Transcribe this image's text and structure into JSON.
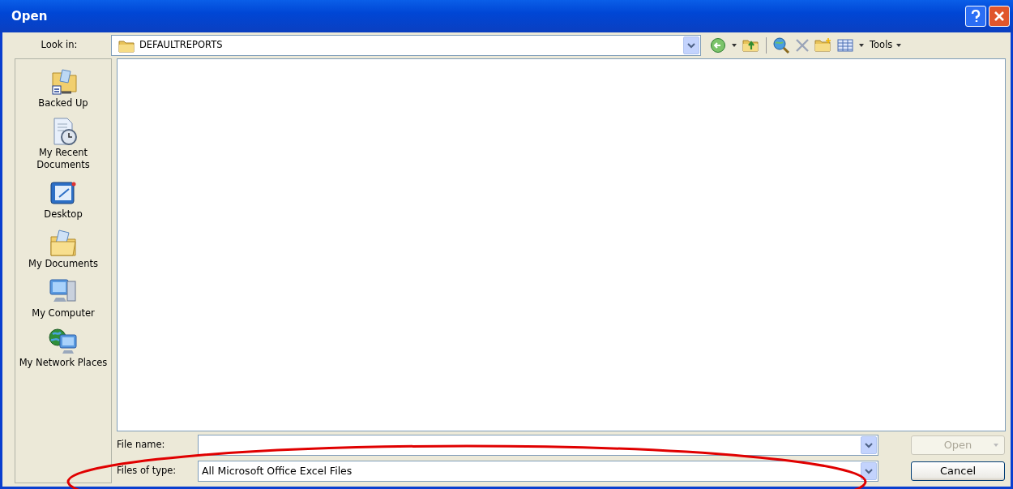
{
  "window": {
    "title": "Open",
    "buttons": [
      {
        "kind": "help"
      },
      {
        "kind": "close"
      }
    ]
  },
  "look_in": {
    "label": "Look in:",
    "value": "DEFAULTREPORTS"
  },
  "toolbar": [
    {
      "kind": "back"
    },
    {
      "kind": "caret"
    },
    {
      "kind": "up"
    },
    {
      "kind": "separator"
    },
    {
      "kind": "search"
    },
    {
      "kind": "delete"
    },
    {
      "kind": "newfolder"
    },
    {
      "kind": "views"
    },
    {
      "kind": "caret"
    },
    {
      "kind": "menu",
      "label": "Tools"
    }
  ],
  "places": [
    {
      "kind": "backup",
      "label": "Backed Up"
    },
    {
      "kind": "recent",
      "label": "My Recent Documents"
    },
    {
      "kind": "desktop",
      "label": "Desktop"
    },
    {
      "kind": "documents",
      "label": "My Documents"
    },
    {
      "kind": "computer",
      "label": "My Computer"
    },
    {
      "kind": "network",
      "label": "My Network Places"
    }
  ],
  "file_name": {
    "label": "File name:"
  },
  "files_of_type": {
    "label": "Files of type:",
    "value": "All Microsoft Office Excel Files"
  },
  "buttons": [
    {
      "label": "Open",
      "disabled": true,
      "split": true
    },
    {
      "label": "Cancel",
      "disabled": false,
      "split": false
    }
  ],
  "annotation": {
    "kind": "ellipse",
    "color": "#e00000"
  }
}
